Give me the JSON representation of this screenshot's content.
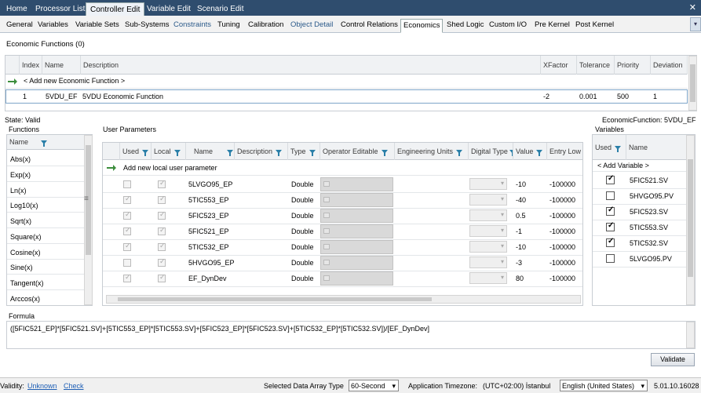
{
  "top_tabs": [
    "Home",
    "Processor List",
    "Controller Edit",
    "Variable Edit",
    "Scenario Edit"
  ],
  "sub_tabs": [
    "General",
    "Variables",
    "Variable Sets",
    "Sub-Systems",
    "Constraints",
    "Tuning",
    "Calibration",
    "Object Detail",
    "Control Relations",
    "Economics",
    "Shed Logic",
    "Custom I/O",
    "Pre Kernel",
    "Post Kernel"
  ],
  "econ": {
    "section_title": "Economic Functions (0)",
    "columns": [
      "Index",
      "Name",
      "Description",
      "XFactor",
      "Tolerance",
      "Priority",
      "Deviation"
    ],
    "add_row": "< Add new Economic Function >",
    "rows": [
      {
        "index": "1",
        "name": "5VDU_EF",
        "description": "5VDU Economic Function",
        "xfactor": "-2",
        "tolerance": "0.001",
        "priority": "500",
        "deviation": "1"
      }
    ]
  },
  "state_text": "State: Valid",
  "econ_function_label": "EconomicFunction: 5VDU_EF",
  "functions": {
    "title": "Functions",
    "header": "Name",
    "items": [
      "Abs(x)",
      "Exp(x)",
      "Ln(x)",
      "Log10(x)",
      "Sqrt(x)",
      "Square(x)",
      "Cosine(x)",
      "Sine(x)",
      "Tangent(x)",
      "Arccos(x)"
    ]
  },
  "user_params": {
    "title": "User Parameters",
    "columns": [
      "Used",
      "Local",
      "Name",
      "Description",
      "Type",
      "Operator Editable",
      "Engineering Units",
      "Digital Type",
      "Value",
      "Entry Low"
    ],
    "add_row": "Add new local user parameter",
    "rows": [
      {
        "used": false,
        "local": true,
        "name": "5LVGO95_EP",
        "description": "",
        "type": "Double",
        "value": "-10",
        "entry_low": "-100000"
      },
      {
        "used": true,
        "local": true,
        "name": "5TIC553_EP",
        "description": "",
        "type": "Double",
        "value": "-40",
        "entry_low": "-100000"
      },
      {
        "used": true,
        "local": true,
        "name": "5FIC523_EP",
        "description": "",
        "type": "Double",
        "value": "0.5",
        "entry_low": "-100000"
      },
      {
        "used": true,
        "local": true,
        "name": "5FIC521_EP",
        "description": "",
        "type": "Double",
        "value": "-1",
        "entry_low": "-100000"
      },
      {
        "used": true,
        "local": true,
        "name": "5TIC532_EP",
        "description": "",
        "type": "Double",
        "value": "-10",
        "entry_low": "-100000"
      },
      {
        "used": false,
        "local": true,
        "name": "5HVGO95_EP",
        "description": "",
        "type": "Double",
        "value": "-3",
        "entry_low": "-100000"
      },
      {
        "used": true,
        "local": true,
        "name": "EF_DynDev",
        "description": "",
        "type": "Double",
        "value": "80",
        "entry_low": "-100000"
      }
    ]
  },
  "variables": {
    "title": "Variables",
    "columns": [
      "Used",
      "Name"
    ],
    "add_row": "< Add Variable >",
    "rows": [
      {
        "used": true,
        "name": "5FIC521.SV"
      },
      {
        "used": false,
        "name": "5HVGO95.PV"
      },
      {
        "used": true,
        "name": "5FIC523.SV"
      },
      {
        "used": true,
        "name": "5TIC553.SV"
      },
      {
        "used": true,
        "name": "5TIC532.SV"
      },
      {
        "used": false,
        "name": "5LVGO95.PV"
      }
    ]
  },
  "formula": {
    "title": "Formula",
    "text": "([5FIC521_EP]*[5FIC521.SV]+[5TIC553_EP]*[5TIC553.SV]+[5FIC523_EP]*[5FIC523.SV]+[5TIC532_EP]*[5TIC532.SV])/[EF_DynDev]"
  },
  "validate_label": "Validate",
  "status": {
    "validity_label": "Validity:",
    "validity_value": "Unknown",
    "check_label": "Check",
    "data_array_label": "Selected Data Array Type",
    "data_array_value": "60-Second",
    "timezone_label": "Application Timezone:",
    "timezone_value": "(UTC+02:00) İstanbul",
    "language": "English (United States)",
    "version": "5.01.10.16028"
  },
  "colors": {
    "title_bar": "#2f4d6e",
    "link": "#1f5fb5",
    "add_icon": "#3d8e3d",
    "filter_icon": "#2a7fa8"
  }
}
